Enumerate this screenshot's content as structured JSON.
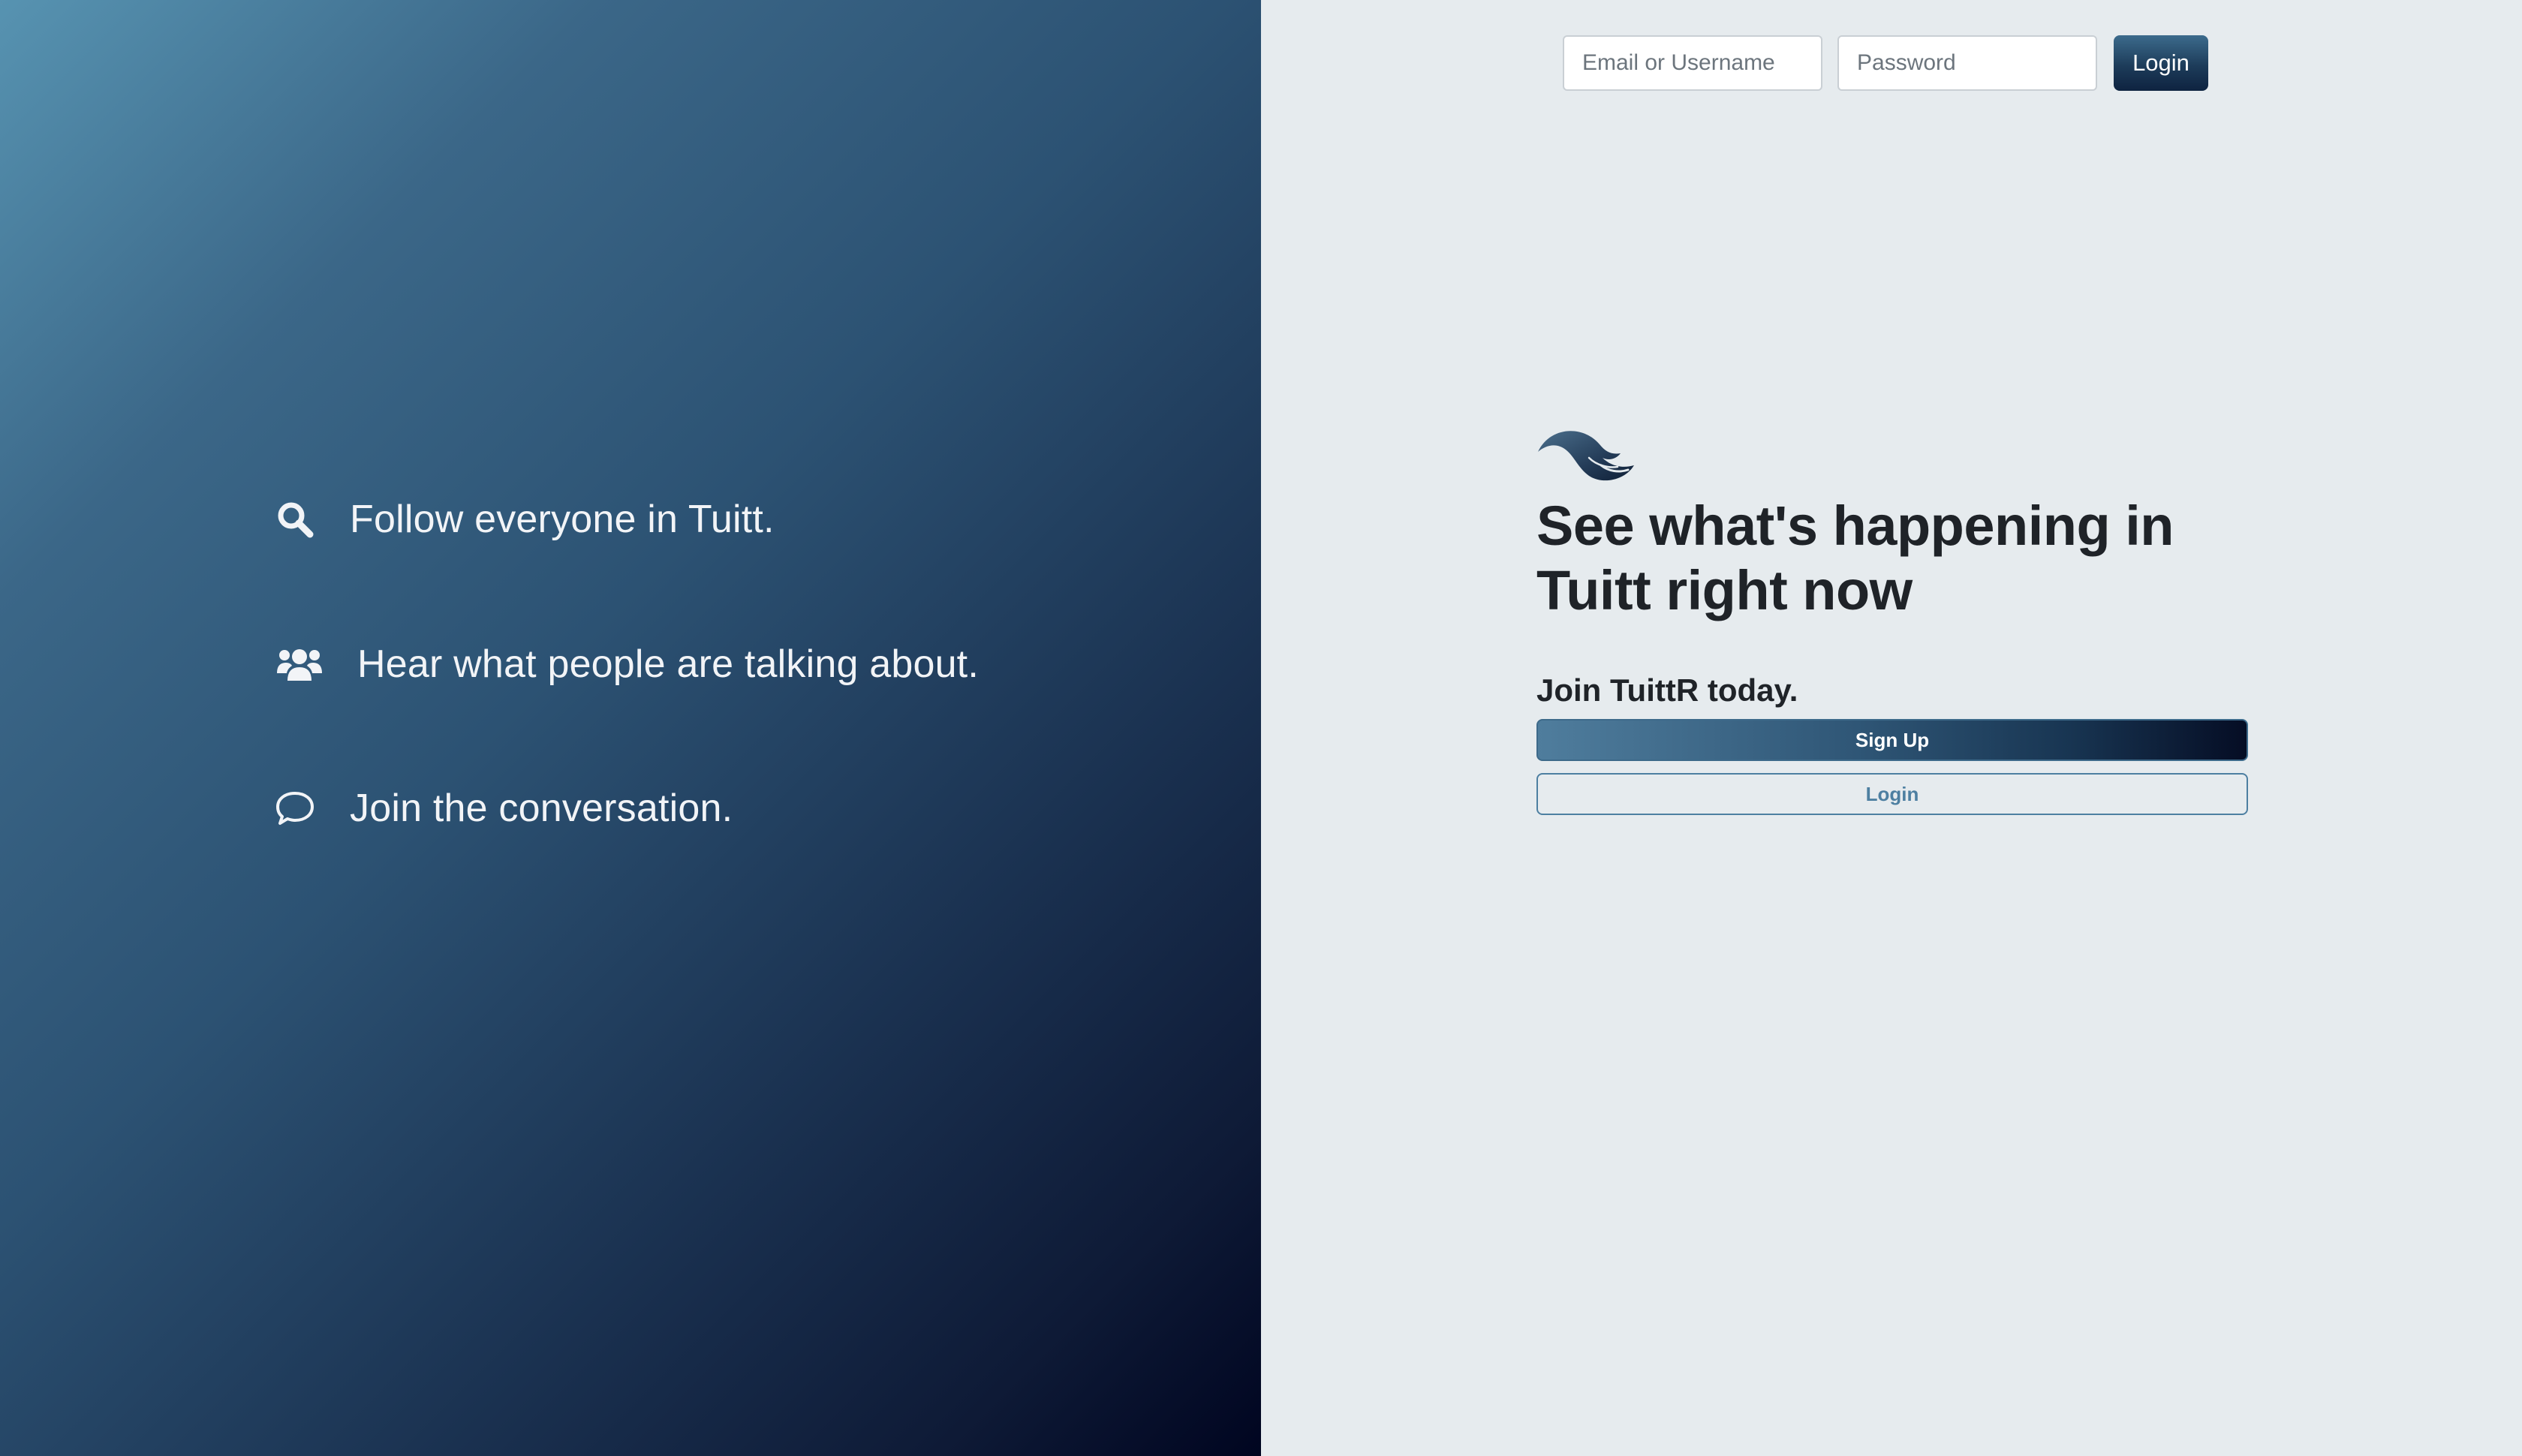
{
  "features": [
    {
      "icon": "search-icon",
      "text": "Follow everyone in Tuitt."
    },
    {
      "icon": "users-icon",
      "text": "Hear what people are talking about."
    },
    {
      "icon": "chat-bubble-icon",
      "text": "Join the conversation."
    }
  ],
  "header": {
    "email_placeholder": "Email or Username",
    "password_placeholder": "Password",
    "login_label": "Login"
  },
  "hero": {
    "logo_icon": "tuitt-logo",
    "headline_line1": "See what's happening in",
    "headline_line2": "Tuitt right now",
    "join_text": "Join TuittR today.",
    "signup_label": "Sign Up",
    "login_label": "Login"
  },
  "colors": {
    "left_gradient_start": "#5793b1",
    "left_gradient_end": "#000520",
    "right_background": "#e6ebee",
    "accent": "#4d7fa1"
  }
}
